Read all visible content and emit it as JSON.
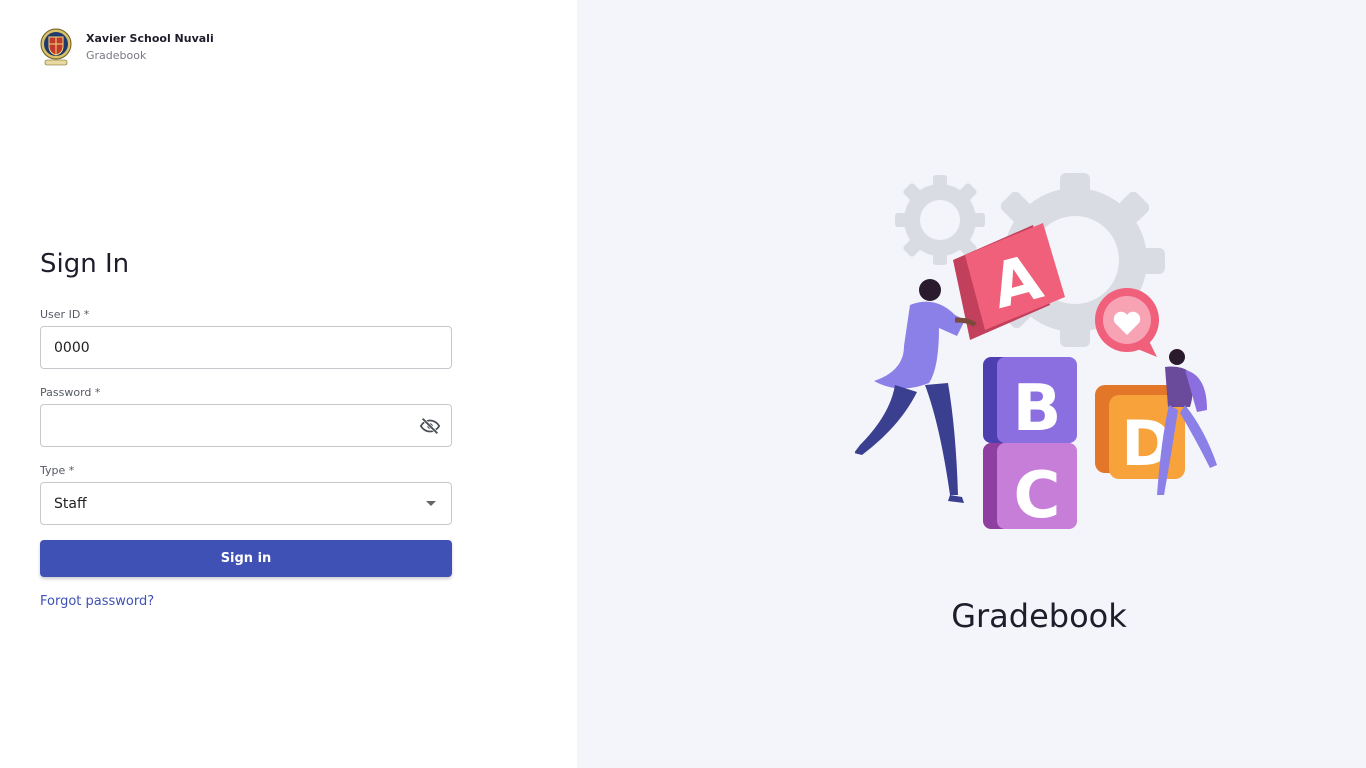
{
  "header": {
    "school_name": "Xavier School Nuvali",
    "app_name": "Gradebook",
    "logo_icon": "school-crest-icon"
  },
  "form": {
    "title": "Sign In",
    "user_id": {
      "label": "User ID *",
      "value": "0000"
    },
    "password": {
      "label": "Password *",
      "value": "",
      "toggle_icon": "eye-off-icon"
    },
    "type": {
      "label": "Type *",
      "value": "Staff",
      "icon": "caret-down-icon"
    },
    "submit_label": "Sign in",
    "forgot_label": "Forgot password?"
  },
  "hero": {
    "title": "Gradebook",
    "illustration": "abc-blocks-illustration",
    "block_letters": [
      "A",
      "B",
      "C",
      "D"
    ]
  },
  "colors": {
    "primary": "#3f51b5",
    "right_panel_bg": "#f4f5fa",
    "block_a": "#f0607a",
    "block_b": "#8b6fe0",
    "block_c": "#c77ed9",
    "block_d": "#f7a23b"
  }
}
